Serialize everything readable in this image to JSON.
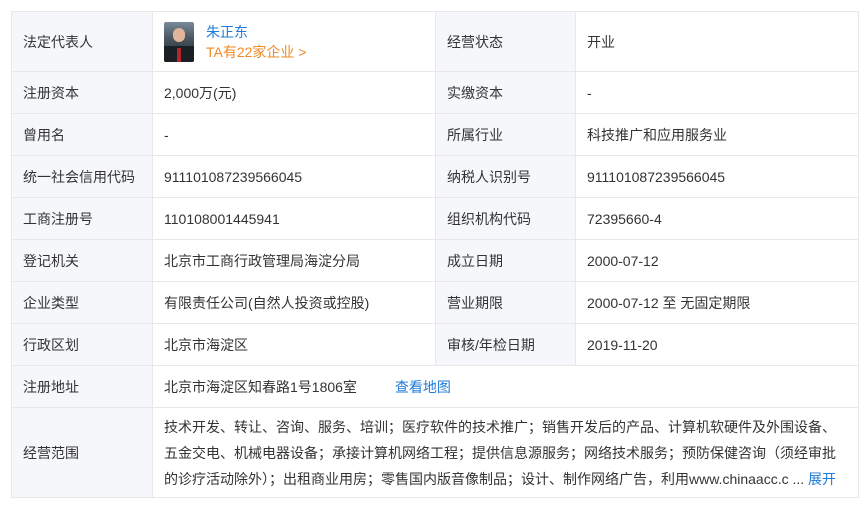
{
  "row1": {
    "legal_rep_label": "法定代表人",
    "legal_rep_name": "朱正东",
    "legal_rep_enterprises": "TA有22家企业 >",
    "status_label": "经营状态",
    "status_value": "开业"
  },
  "row2": {
    "reg_capital_label": "注册资本",
    "reg_capital_value": "2,000万(元)",
    "paid_capital_label": "实缴资本",
    "paid_capital_value": "-"
  },
  "row3": {
    "former_name_label": "曾用名",
    "former_name_value": "-",
    "industry_label": "所属行业",
    "industry_value": "科技推广和应用服务业"
  },
  "row4": {
    "credit_code_label": "统一社会信用代码",
    "credit_code_value": "911101087239566045",
    "taxpayer_label": "纳税人识别号",
    "taxpayer_value": "911101087239566045"
  },
  "row5": {
    "reg_no_label": "工商注册号",
    "reg_no_value": "110108001445941",
    "org_code_label": "组织机构代码",
    "org_code_value": "72395660-4"
  },
  "row6": {
    "authority_label": "登记机关",
    "authority_value": "北京市工商行政管理局海淀分局",
    "founded_label": "成立日期",
    "founded_value": "2000-07-12"
  },
  "row7": {
    "type_label": "企业类型",
    "type_value": "有限责任公司(自然人投资或控股)",
    "term_label": "营业期限",
    "term_value": "2000-07-12 至 无固定期限"
  },
  "row8": {
    "district_label": "行政区划",
    "district_value": "北京市海淀区",
    "audit_label": "审核/年检日期",
    "audit_value": "2019-11-20"
  },
  "row9": {
    "address_label": "注册地址",
    "address_value": "北京市海淀区知春路1号1806室",
    "map_link": "查看地图"
  },
  "row10": {
    "scope_label": "经营范围",
    "scope_line1": "技术开发、转让、咨询、服务、培训；医疗软件的技术推广；销售开发后的产品、计算机软硬件及外围设备、",
    "scope_line2": "五金交电、机械电器设备；承接计算机网络工程；提供信息源服务；网络技术服务；预防保健咨询（须经审批",
    "scope_line3": "的诊疗活动除外）；出租商业用房；零售国内版音像制品；设计、制作网络广告，利用www.chinaacc.c",
    "ellipsis": "...",
    "expand": "展开"
  }
}
